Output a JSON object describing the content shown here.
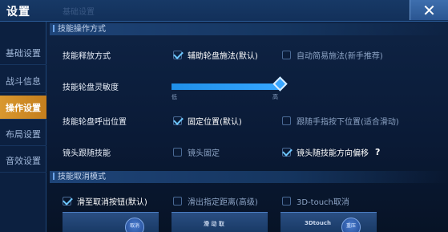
{
  "window": {
    "title": "设置",
    "faded_tab": "基础设置",
    "close_glyph": "✕"
  },
  "sidebar": {
    "items": [
      {
        "label": "基础设置",
        "active": false
      },
      {
        "label": "战斗信息",
        "active": false
      },
      {
        "label": "操作设置",
        "active": true
      },
      {
        "label": "布局设置",
        "active": false
      },
      {
        "label": "音效设置",
        "active": false
      }
    ]
  },
  "sections": {
    "operation": "技能操作方式",
    "cancel": "技能取消模式"
  },
  "rows": {
    "release": {
      "label": "技能释放方式",
      "options": [
        {
          "text": "辅助轮盘施法(默认)",
          "checked": true
        },
        {
          "text": "自动简易施法(新手推荐)",
          "checked": false
        }
      ]
    },
    "sensitivity": {
      "label": "技能轮盘灵敏度",
      "value": 1.0,
      "low": "低",
      "high": "高"
    },
    "position": {
      "label": "技能轮盘呼出位置",
      "options": [
        {
          "text": "固定位置(默认)",
          "checked": true
        },
        {
          "text": "跟随手指按下位置(适合滑动)",
          "checked": false
        }
      ]
    },
    "camera": {
      "label": "镜头跟随技能",
      "options": [
        {
          "text": "镜头固定",
          "checked": false
        },
        {
          "text": "镜头随技能方向偏移",
          "checked": true
        }
      ],
      "help": "?"
    },
    "cancel_mode": {
      "options": [
        {
          "text": "滑至取消按钮(默认)",
          "checked": true
        },
        {
          "text": "滑出指定距离(高级)",
          "checked": false
        },
        {
          "text": "3D-touch取消",
          "checked": false
        }
      ]
    }
  },
  "previews": [
    {
      "button": "取消"
    },
    {
      "label": "滑 动 取"
    },
    {
      "label": "3Dtouch",
      "button": "重压"
    }
  ],
  "colors": {
    "accent": "#3aa6ff",
    "active_tab": "#d9982f",
    "background": "#0b1a33"
  }
}
